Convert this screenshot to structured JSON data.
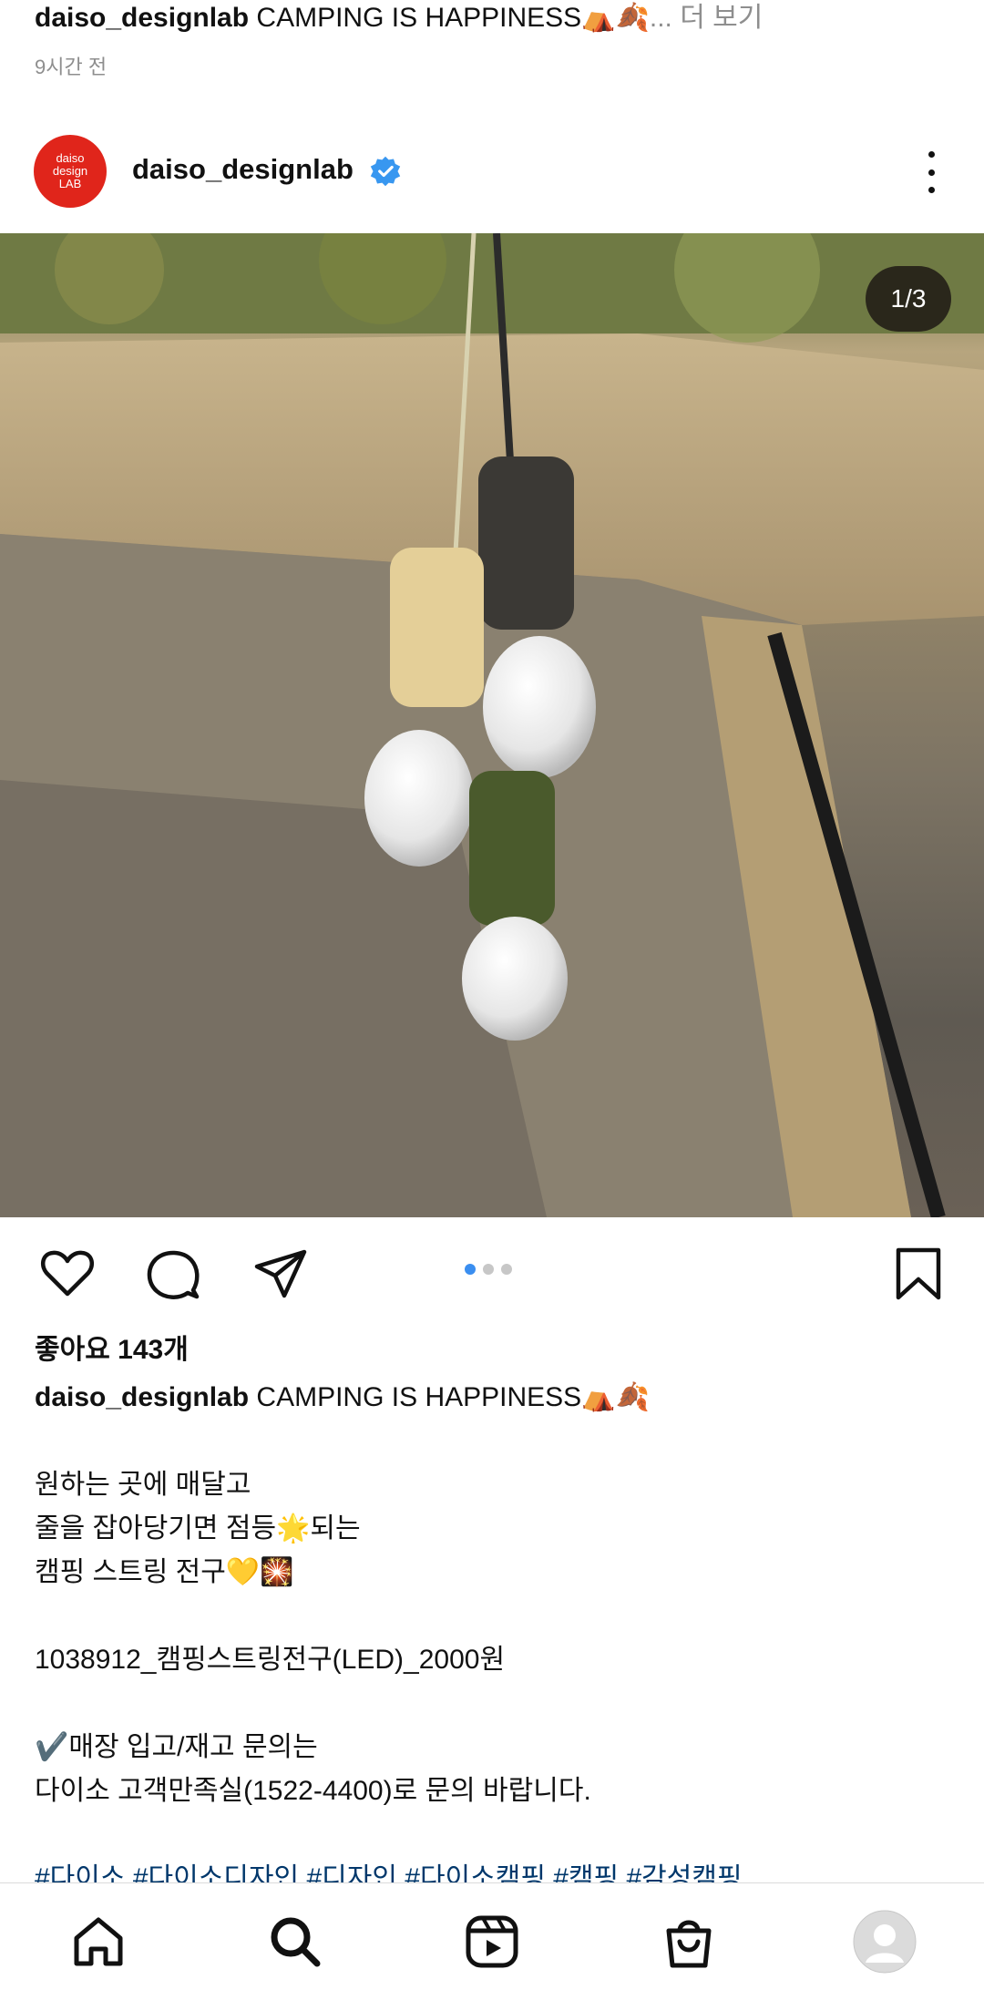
{
  "prev_post": {
    "username": "daiso_designlab",
    "caption": " CAMPING IS HAPPINESS⛺🍂",
    "more": "... 더 보기",
    "time": "9시간 전"
  },
  "post": {
    "avatar_text": [
      "daiso",
      "design",
      "LAB"
    ],
    "username": "daiso_designlab",
    "counter": "1/3",
    "likes": "좋아요 143개",
    "caption_title": " CAMPING IS HAPPINESS⛺🍂",
    "caption_lines": [
      "",
      "원하는 곳에 매달고",
      "줄을 잡아당기면 점등🌟되는",
      "캠핑 스트링 전구💛🎇",
      "",
      "1038912_캠핑스트링전구(LED)_2000원",
      "",
      "✔️매장 입고/재고 문의는",
      "다이소 고객만족실(1522-4400)로 문의 바랍니다.",
      ""
    ],
    "hashtags": "#다이소 #다이소디자인 #디자인 #다이소캠핑 #캠핑 #감성캠핑",
    "carousel_total": 3,
    "carousel_index": 1
  },
  "colors": {
    "verified": "#3897f0",
    "avatar_bg": "#e0251b",
    "dot_active": "#3a8ef0"
  },
  "icons": [
    "heart-icon",
    "comment-icon",
    "share-icon",
    "bookmark-icon",
    "home-icon",
    "search-icon",
    "reels-icon",
    "shop-icon",
    "profile-icon",
    "more-icon",
    "verified-icon"
  ]
}
